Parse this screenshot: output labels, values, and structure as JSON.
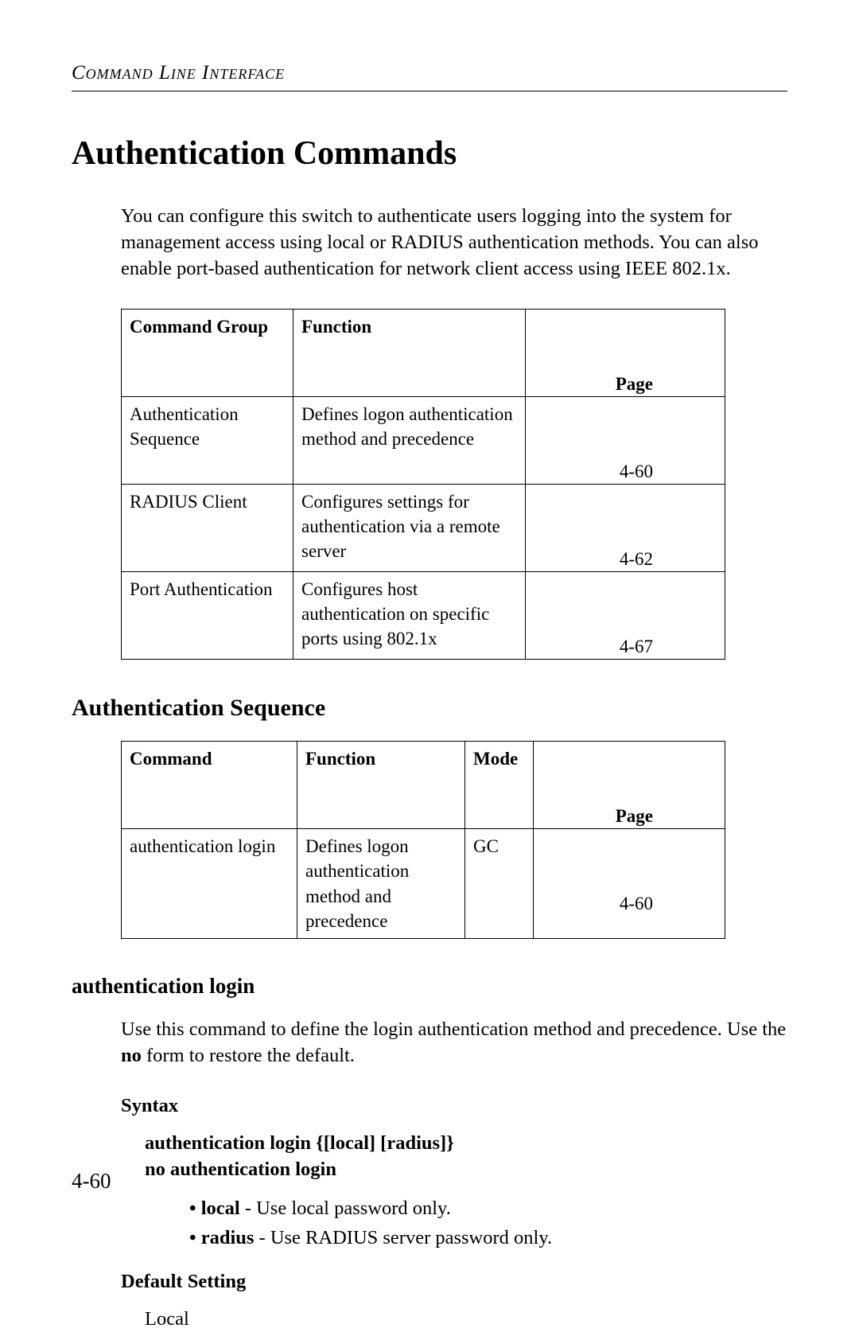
{
  "header": "Command Line Interface",
  "title": "Authentication Commands",
  "intro": "You can configure this switch to authenticate users logging into the system for management access using local or RADIUS authentication methods. You can also enable port-based authentication for network client access using IEEE 802.1x.",
  "table1": {
    "headers": {
      "h1": "Command Group",
      "h2": "Function",
      "h3": "Page"
    },
    "rows": [
      {
        "group": "Authentication Sequence",
        "function": "Defines logon authentication method and precedence",
        "page": "4-60"
      },
      {
        "group": "RADIUS Client",
        "function": "Configures settings for authentication via a remote server",
        "page": "4-62"
      },
      {
        "group": "Port Authentication",
        "function": "Configures host authentication on specific ports using 802.1x",
        "page": "4-67"
      }
    ]
  },
  "section2_title": "Authentication Sequence",
  "table2": {
    "headers": {
      "h1": "Command",
      "h2": "Function",
      "h3": "Mode",
      "h4": "Page"
    },
    "rows": [
      {
        "command": "authentication login",
        "function": "Defines logon authentication method and precedence",
        "mode": "GC",
        "page": "4-60"
      }
    ]
  },
  "section3_title": "authentication login",
  "desc_pre": "Use this command to define the login authentication method and precedence. Use the ",
  "desc_bold": "no",
  "desc_post": " form to restore the default.",
  "syntax_label": "Syntax",
  "syntax_line1": "authentication login {[local] [radius]}",
  "syntax_line2": "no authentication login",
  "bullet1_bold": "local",
  "bullet1_rest": " - Use local password only.",
  "bullet2_bold": "radius",
  "bullet2_rest": " - Use RADIUS server password only.",
  "default_label": "Default Setting",
  "default_value": "Local",
  "pagenum": "4-60"
}
